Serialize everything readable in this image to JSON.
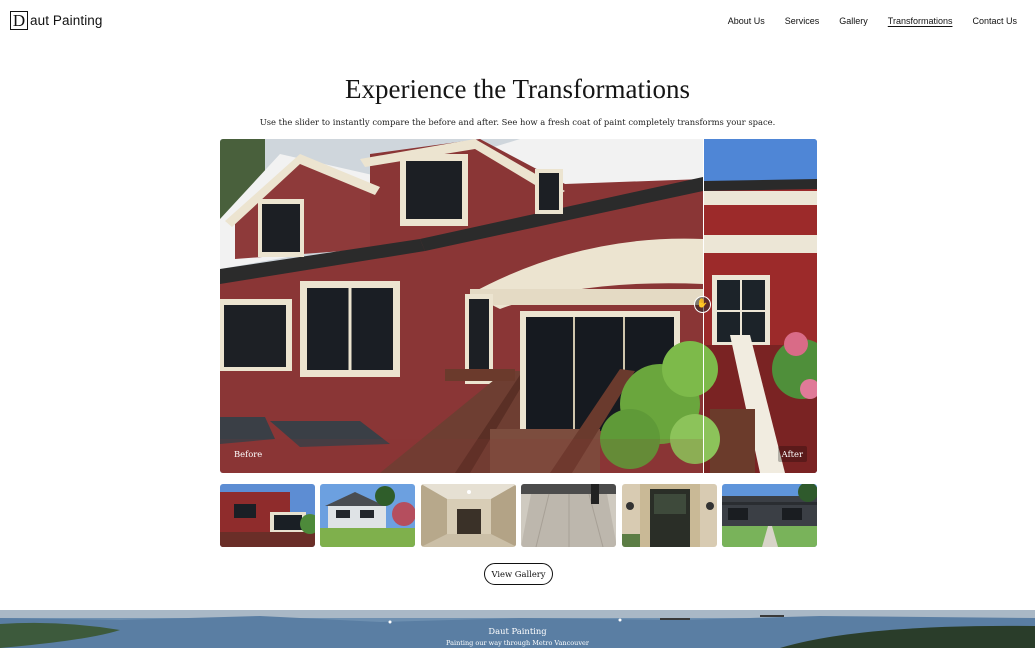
{
  "header": {
    "logo_letter": "D",
    "logo_rest": "aut Painting",
    "nav": [
      {
        "label": "About Us",
        "active": false
      },
      {
        "label": "Services",
        "active": false
      },
      {
        "label": "Gallery",
        "active": false
      },
      {
        "label": "Transformations",
        "active": true
      },
      {
        "label": "Contact Us",
        "active": false
      }
    ]
  },
  "main": {
    "title": "Experience the Transformations",
    "subtitle": "Use the slider to instantly compare the before and after. See how a fresh coat of paint completely transforms your space.",
    "slider": {
      "before_label": "Before",
      "after_label": "After",
      "position": 0.81
    },
    "thumbnails": [
      {
        "name": "thumb-red-house"
      },
      {
        "name": "thumb-white-house"
      },
      {
        "name": "thumb-interior-room"
      },
      {
        "name": "thumb-deck"
      },
      {
        "name": "thumb-front-door"
      },
      {
        "name": "thumb-modern-house"
      }
    ],
    "view_gallery_label": "View Gallery"
  },
  "footer": {
    "title": "Daut Painting",
    "tagline": "Painting our way through Metro Vancouver"
  },
  "colors": {
    "text": "#111111",
    "house_before": "#8e3a3a",
    "house_after": "#9c2a2a",
    "trim": "#e9e2cf",
    "sky": "#4f86d6"
  }
}
